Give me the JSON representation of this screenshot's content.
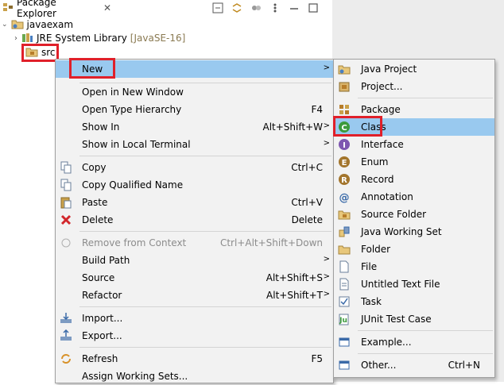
{
  "view": {
    "title": "Package Explorer",
    "close": "✕"
  },
  "tree": {
    "project": "javaexam",
    "library": "JRE System Library",
    "library_tag": "[JavaSE-16]",
    "src": "src"
  },
  "context_menu": {
    "items": [
      {
        "label": "New",
        "shortcut": "",
        "submenu": true
      },
      {
        "label": "Open in New Window",
        "shortcut": ""
      },
      {
        "label": "Open Type Hierarchy",
        "shortcut": "F4"
      },
      {
        "label": "Show In",
        "shortcut": "Alt+Shift+W",
        "submenu": true
      },
      {
        "label": "Show in Local Terminal",
        "shortcut": "",
        "submenu": true
      },
      {
        "label": "Copy",
        "shortcut": "Ctrl+C"
      },
      {
        "label": "Copy Qualified Name",
        "shortcut": ""
      },
      {
        "label": "Paste",
        "shortcut": "Ctrl+V"
      },
      {
        "label": "Delete",
        "shortcut": "Delete"
      },
      {
        "label": "Remove from Context",
        "shortcut": "Ctrl+Alt+Shift+Down",
        "disabled": true
      },
      {
        "label": "Build Path",
        "shortcut": "",
        "submenu": true
      },
      {
        "label": "Source",
        "shortcut": "Alt+Shift+S",
        "submenu": true
      },
      {
        "label": "Refactor",
        "shortcut": "Alt+Shift+T",
        "submenu": true
      },
      {
        "label": "Import...",
        "shortcut": ""
      },
      {
        "label": "Export...",
        "shortcut": ""
      },
      {
        "label": "Refresh",
        "shortcut": "F5"
      },
      {
        "label": "Assign Working Sets...",
        "shortcut": ""
      }
    ]
  },
  "new_submenu": {
    "items": [
      {
        "label": "Java Project",
        "shortcut": ""
      },
      {
        "label": "Project...",
        "shortcut": ""
      },
      {
        "label": "Package",
        "shortcut": ""
      },
      {
        "label": "Class",
        "shortcut": "",
        "highlighted": true
      },
      {
        "label": "Interface",
        "shortcut": ""
      },
      {
        "label": "Enum",
        "shortcut": ""
      },
      {
        "label": "Record",
        "shortcut": ""
      },
      {
        "label": "Annotation",
        "shortcut": ""
      },
      {
        "label": "Source Folder",
        "shortcut": ""
      },
      {
        "label": "Java Working Set",
        "shortcut": ""
      },
      {
        "label": "Folder",
        "shortcut": ""
      },
      {
        "label": "File",
        "shortcut": ""
      },
      {
        "label": "Untitled Text File",
        "shortcut": ""
      },
      {
        "label": "Task",
        "shortcut": ""
      },
      {
        "label": "JUnit Test Case",
        "shortcut": ""
      },
      {
        "label": "Example...",
        "shortcut": ""
      },
      {
        "label": "Other...",
        "shortcut": "Ctrl+N"
      }
    ]
  },
  "colors": {
    "highlight": "#99c9ef",
    "annotation_box": "#e0202a",
    "menu_bg": "#f2f2f2"
  }
}
